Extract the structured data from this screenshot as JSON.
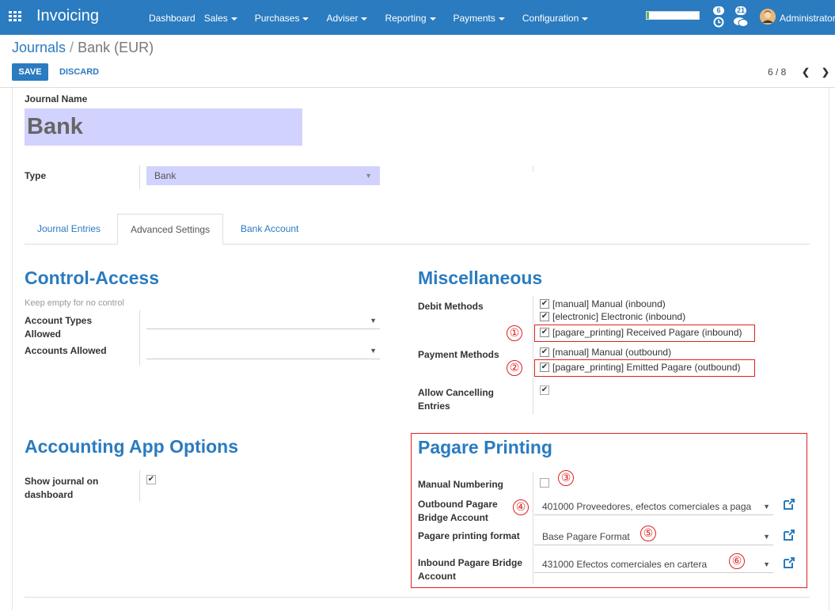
{
  "app": {
    "name": "Invoicing"
  },
  "topbar": {
    "menu": [
      "Dashboard",
      "Sales",
      "Purchases",
      "Adviser",
      "Reporting",
      "Payments",
      "Configuration"
    ],
    "menu_has_caret": [
      false,
      true,
      true,
      true,
      true,
      true,
      true
    ],
    "activity_count": "6",
    "message_count": "21",
    "user": "Administrator",
    "progress_fraction": 0.04
  },
  "breadcrumb": {
    "parent": "Journals",
    "current": "Bank (EUR)"
  },
  "buttons": {
    "save": "SAVE",
    "discard": "DISCARD"
  },
  "pager": {
    "value": "6 / 8",
    "prev": "❮",
    "next": "❯"
  },
  "form": {
    "journal_name_label": "Journal Name",
    "journal_name": "Bank",
    "type_label": "Type",
    "type_value": "Bank",
    "tabs": [
      "Journal Entries",
      "Advanced Settings",
      "Bank Account"
    ],
    "active_tab": "Advanced Settings",
    "control_access": {
      "title": "Control-Access",
      "help": "Keep empty for no control",
      "account_types_label": "Account Types Allowed",
      "accounts_label": "Accounts Allowed"
    },
    "misc": {
      "title": "Miscellaneous",
      "debit_label": "Debit Methods",
      "debit_methods": [
        "[manual] Manual (inbound)",
        "[electronic] Electronic (inbound)",
        "[pagare_printing] Received Pagare (inbound)"
      ],
      "payment_label": "Payment Methods",
      "payment_methods": [
        "[manual] Manual (outbound)",
        "[pagare_printing] Emitted Pagare (outbound)"
      ],
      "cancel_label": "Allow Cancelling Entries"
    },
    "accounting": {
      "title": "Accounting App Options",
      "dashboard_label": "Show journal on dashboard"
    },
    "pagare": {
      "title": "Pagare Printing",
      "manual_label": "Manual Numbering",
      "outbound_label": "Outbound Pagare Bridge Account",
      "outbound_value": "401000 Proveedores, efectos comerciales a paga",
      "format_label": "Pagare printing format",
      "format_value": "Base Pagare Format",
      "inbound_label": "Inbound Pagare Bridge Account",
      "inbound_value": "431000 Efectos comerciales en cartera"
    }
  },
  "annotations": [
    "①",
    "②",
    "③",
    "④",
    "⑤",
    "⑥"
  ],
  "colors": {
    "brand": "#2a7bc0",
    "annotation": "#e02020",
    "required_field": "#d2d2ff"
  }
}
